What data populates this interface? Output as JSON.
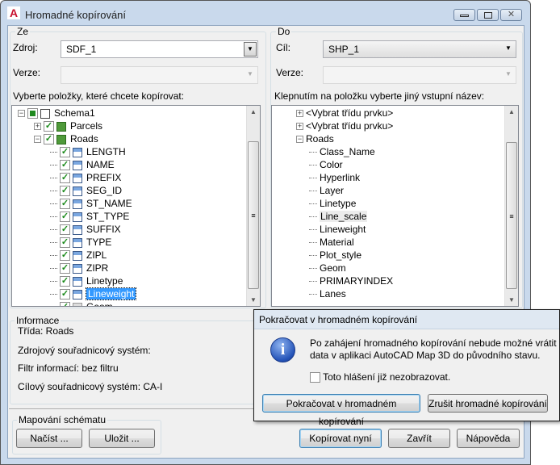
{
  "window": {
    "title": "Hromadné kopírování",
    "app_icon": "autocad-a-icon",
    "controls": [
      "minimize",
      "maximize",
      "close"
    ]
  },
  "from": {
    "group": "Ze",
    "source_label": "Zdroj:",
    "source_value": "SDF_1",
    "version_label": "Verze:",
    "version_value": "",
    "list_label": "Vyberte položky, které chcete kopírovat:",
    "tree": [
      {
        "label": "Schema1",
        "level": 0,
        "expander": "minus",
        "checked": "partial",
        "icon": "schema-icon"
      },
      {
        "label": "Parcels",
        "level": 1,
        "expander": "plus",
        "checked": true,
        "icon": "feature-class-icon"
      },
      {
        "label": "Roads",
        "level": 1,
        "expander": "minus",
        "checked": true,
        "icon": "feature-class-icon"
      },
      {
        "label": "LENGTH",
        "level": 2,
        "checked": true,
        "icon": "property-icon"
      },
      {
        "label": "NAME",
        "level": 2,
        "checked": true,
        "icon": "property-icon"
      },
      {
        "label": "PREFIX",
        "level": 2,
        "checked": true,
        "icon": "property-icon"
      },
      {
        "label": "SEG_ID",
        "level": 2,
        "checked": true,
        "icon": "property-icon"
      },
      {
        "label": "ST_NAME",
        "level": 2,
        "checked": true,
        "icon": "property-icon"
      },
      {
        "label": "ST_TYPE",
        "level": 2,
        "checked": true,
        "icon": "property-icon"
      },
      {
        "label": "SUFFIX",
        "level": 2,
        "checked": true,
        "icon": "property-icon"
      },
      {
        "label": "TYPE",
        "level": 2,
        "checked": true,
        "icon": "property-icon"
      },
      {
        "label": "ZIPL",
        "level": 2,
        "checked": true,
        "icon": "property-icon"
      },
      {
        "label": "ZIPR",
        "level": 2,
        "checked": true,
        "icon": "property-icon"
      },
      {
        "label": "Linetype",
        "level": 2,
        "checked": true,
        "icon": "property-icon"
      },
      {
        "label": "Lineweight",
        "level": 2,
        "checked": true,
        "icon": "property-icon",
        "selected": true
      },
      {
        "label": "Geom",
        "level": 2,
        "checked": true,
        "icon": "geometry-icon"
      }
    ]
  },
  "to": {
    "group": "Do",
    "target_label": "Cíl:",
    "target_value": "SHP_1",
    "version_label": "Verze:",
    "version_value": "",
    "list_label": "Klepnutím na položku vyberte jiný vstupní název:",
    "tree": [
      {
        "label": "<Vybrat třídu prvku>",
        "level": 0,
        "expander": "plus"
      },
      {
        "label": "<Vybrat třídu prvku>",
        "level": 0,
        "expander": "plus"
      },
      {
        "label": "Roads",
        "level": 0,
        "expander": "minus"
      },
      {
        "label": "Class_Name",
        "level": 1
      },
      {
        "label": "Color",
        "level": 1
      },
      {
        "label": "Hyperlink",
        "level": 1
      },
      {
        "label": "Layer",
        "level": 1
      },
      {
        "label": "Linetype",
        "level": 1
      },
      {
        "label": "Line_scale",
        "level": 1,
        "hover": true
      },
      {
        "label": "Lineweight",
        "level": 1
      },
      {
        "label": "Material",
        "level": 1
      },
      {
        "label": "Plot_style",
        "level": 1
      },
      {
        "label": "Geom",
        "level": 1
      },
      {
        "label": "PRIMARYINDEX",
        "level": 1
      },
      {
        "label": "Lanes",
        "level": 1
      }
    ]
  },
  "info": {
    "group": "Informace",
    "lines": [
      "Třída: Roads",
      "Zdrojový souřadnicový systém:",
      "Filtr informací: bez filtru",
      "Cílový souřadnicový systém: CA-I"
    ]
  },
  "mapping": {
    "group": "Mapování schématu",
    "load": "Načíst ...",
    "save": "Uložit ..."
  },
  "buttons": {
    "copy_now": "Kopírovat nyní",
    "close": "Zavřít",
    "help": "Nápověda"
  },
  "dialog": {
    "title": "Pokračovat v hromadném kopírování",
    "icon": "info-icon",
    "message_line1": "Po zahájení hromadného kopírování nebude možné vrátit",
    "message_line2": "data v aplikaci AutoCAD Map 3D do původního stavu.",
    "checkbox_label": "Toto hlášení již nezobrazovat.",
    "checkbox_checked": false,
    "continue": "Pokračovat v hromadném kopírování",
    "cancel": "Zrušit hromadné kopírování"
  }
}
